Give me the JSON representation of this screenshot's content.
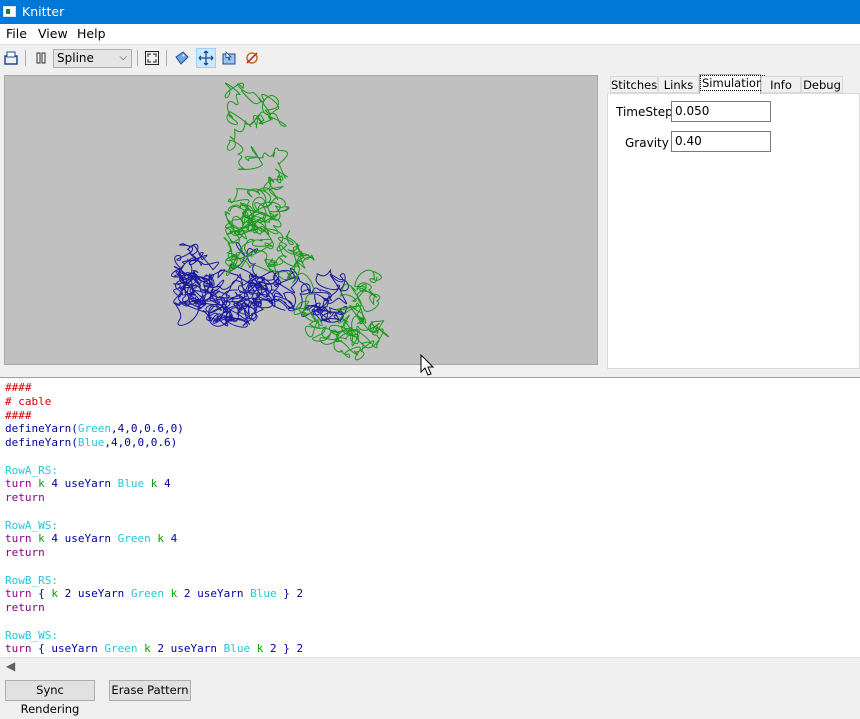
{
  "window": {
    "title": "Knitter"
  },
  "menu": {
    "items": [
      "File",
      "View",
      "Help"
    ]
  },
  "toolbar": {
    "render_mode": "Spline",
    "icons": [
      "open-file-icon",
      "pause-icon",
      "fit-view-icon",
      "tag-icon",
      "move-icon",
      "select-icon",
      "no-physics-icon"
    ]
  },
  "tabs": [
    "Stitches",
    "Links",
    "Simulation",
    "Info",
    "Debug"
  ],
  "simulation": {
    "timestep_label": "TimeStep",
    "timestep_value": "0.050",
    "gravity_label": "Gravity",
    "gravity_value": "0.40"
  },
  "colors": {
    "yarn_green": "#1a9a1a",
    "yarn_blue": "#1a1aa0",
    "comment": "#d40000",
    "label": "#20c8d8",
    "keyword": "#8a008a",
    "identifier": "#0000a0",
    "number": "#00a000"
  },
  "code": [
    [
      [
        "####",
        "comment"
      ]
    ],
    [
      [
        "# cable",
        "comment"
      ]
    ],
    [
      [
        "####",
        "comment"
      ]
    ],
    [
      [
        "defineYarn",
        "identifier"
      ],
      [
        "(",
        "plain"
      ],
      [
        "Green",
        "label"
      ],
      [
        ",4,0,0.6,0)",
        "plain"
      ]
    ],
    [
      [
        "defineYarn",
        "identifier"
      ],
      [
        "(",
        "plain"
      ],
      [
        "Blue",
        "label"
      ],
      [
        ",4,0,0,0.6)",
        "plain"
      ]
    ],
    [],
    [
      [
        "RowA_RS:",
        "label"
      ]
    ],
    [
      [
        "turn",
        "keyword"
      ],
      [
        " ",
        "plain"
      ],
      [
        "k",
        "number"
      ],
      [
        " 4 ",
        "identifier"
      ],
      [
        "useYarn",
        "identifier"
      ],
      [
        " ",
        "plain"
      ],
      [
        "Blue",
        "label"
      ],
      [
        " ",
        "plain"
      ],
      [
        "k",
        "number"
      ],
      [
        " 4",
        "identifier"
      ]
    ],
    [
      [
        "return",
        "keyword"
      ]
    ],
    [],
    [
      [
        "RowA_WS:",
        "label"
      ]
    ],
    [
      [
        "turn",
        "keyword"
      ],
      [
        " ",
        "plain"
      ],
      [
        "k",
        "number"
      ],
      [
        " 4 ",
        "identifier"
      ],
      [
        "useYarn",
        "identifier"
      ],
      [
        " ",
        "plain"
      ],
      [
        "Green",
        "label"
      ],
      [
        " ",
        "plain"
      ],
      [
        "k",
        "number"
      ],
      [
        " 4",
        "identifier"
      ]
    ],
    [
      [
        "return",
        "keyword"
      ]
    ],
    [],
    [
      [
        "RowB_RS:",
        "label"
      ]
    ],
    [
      [
        "turn",
        "keyword"
      ],
      [
        " { ",
        "plain"
      ],
      [
        "k",
        "number"
      ],
      [
        " 2 ",
        "identifier"
      ],
      [
        "useYarn",
        "identifier"
      ],
      [
        " ",
        "plain"
      ],
      [
        "Green",
        "label"
      ],
      [
        " ",
        "plain"
      ],
      [
        "k",
        "number"
      ],
      [
        " 2 ",
        "identifier"
      ],
      [
        "useYarn",
        "identifier"
      ],
      [
        " ",
        "plain"
      ],
      [
        "Blue",
        "label"
      ],
      [
        " } 2",
        "identifier"
      ]
    ],
    [
      [
        "return",
        "keyword"
      ]
    ],
    [],
    [
      [
        "RowB_WS:",
        "label"
      ]
    ],
    [
      [
        "turn",
        "keyword"
      ],
      [
        " { ",
        "plain"
      ],
      [
        "useYarn",
        "identifier"
      ],
      [
        " ",
        "plain"
      ],
      [
        "Green",
        "label"
      ],
      [
        " ",
        "plain"
      ],
      [
        "k",
        "number"
      ],
      [
        " 2 ",
        "identifier"
      ],
      [
        "useYarn",
        "identifier"
      ],
      [
        " ",
        "plain"
      ],
      [
        "Blue",
        "label"
      ],
      [
        " ",
        "plain"
      ],
      [
        "k",
        "number"
      ],
      [
        " 2",
        "identifier"
      ],
      [
        " } 2",
        "identifier"
      ]
    ]
  ],
  "buttons": {
    "sync": "Sync Rendering",
    "erase": "Erase Pattern"
  }
}
